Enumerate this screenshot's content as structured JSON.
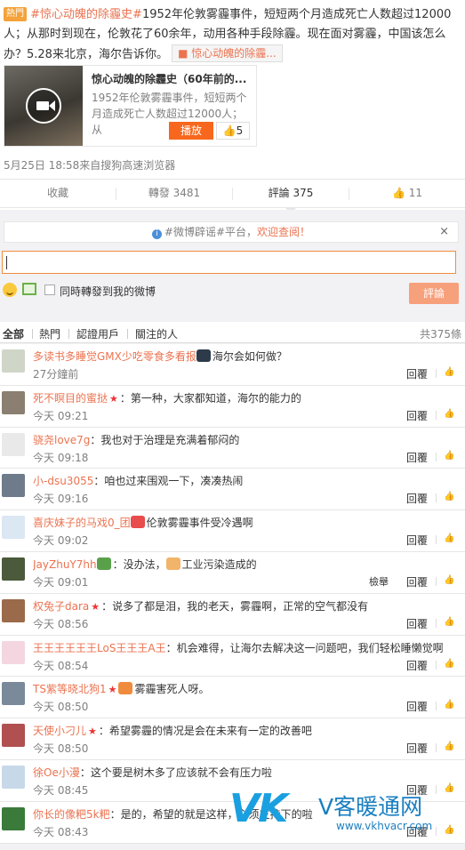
{
  "post": {
    "hot_badge": "熱門",
    "topic": "#惊心动魄的除霾史#",
    "text": "1952年伦敦雾霾事件，短短两个月造成死亡人数超过12000人；从那时到现在，伦敦花了60余年，动用各种手段除霾。现在面对雾霾，中国该怎么办？5.28来北京，海尔告诉你。",
    "inline_card": "惊心动魄的除霾...",
    "video_title": "惊心动魄的除霾史（60年前的...",
    "video_desc": "1952年伦敦雾霾事件，短短两个月造成死亡人数超过12000人；从",
    "play_label": "播放",
    "like_count": "5",
    "meta": "5月25日 18:58来自搜狗高速浏览器"
  },
  "actions": {
    "collect": "收藏",
    "repost": "轉發 3481",
    "comment": "評論 375",
    "like": "11"
  },
  "comment_box": {
    "notice_prefix": "#微博辟谣#平台，",
    "notice_link": "欢迎查阅！",
    "close": "×",
    "repost_check_label": "同時轉發到我的微博",
    "submit": "評論"
  },
  "tabs": {
    "all": "全部",
    "hot": "熱門",
    "verified": "認證用戶",
    "following": "關注的人",
    "total": "共375條"
  },
  "colors": {
    "accent": "#eb7350",
    "play": "#f7671d"
  },
  "comments": [
    {
      "user": "多读书多睡觉GMX少吃零食多看报",
      "star": false,
      "text": "海尔会如何做？",
      "sticker": "#2d3a4a",
      "time": "27分鐘前",
      "report": "",
      "reply": "回覆"
    },
    {
      "user": "死不瞑目的蜜挞",
      "star": true,
      "text": "：第一种，大家都知道，海尔的能力的",
      "sticker": "",
      "time": "今天 09:21",
      "report": "",
      "reply": "回覆"
    },
    {
      "user": "骁尧love7g",
      "star": false,
      "text": "：我也对于治理是充满着郁闷的",
      "sticker": "",
      "time": "今天 09:18",
      "report": "",
      "reply": "回覆"
    },
    {
      "user": "小-dsu3055",
      "star": false,
      "text": "：咱也过来围观一下，凑凑热闹",
      "sticker": "",
      "time": "今天 09:16",
      "report": "",
      "reply": "回覆"
    },
    {
      "user": "喜庆妹子的马戏0_团",
      "star": false,
      "text": "伦敦雾霾事件受冷遇啊",
      "sticker": "#e94c4c",
      "time": "今天 09:02",
      "report": "",
      "reply": "回覆"
    },
    {
      "user": "JayZhuY7hh",
      "star": false,
      "text": "：没办法，",
      "text2": "工业污染造成的",
      "sticker": "#5aa04a",
      "time": "今天 09:01",
      "report": "檢舉",
      "reply": "回覆"
    },
    {
      "user": "权兔子dara",
      "star": true,
      "text": "：说多了都是泪，我的老天，雾霾啊，正常的空气都没有",
      "sticker": "",
      "time": "今天 08:56",
      "report": "",
      "reply": "回覆"
    },
    {
      "user": "王王王王王王LoS王王王A王",
      "star": false,
      "text": "：机会难得，让海尔去解决这一问题吧，我们轻松睡懒觉啊",
      "sticker": "",
      "time": "今天 08:54",
      "report": "",
      "reply": "回覆"
    },
    {
      "user": "TS紫等晓北狗1",
      "star": true,
      "text": "雾霾害死人呀。",
      "sticker": "#f08b3d",
      "time": "今天 08:50",
      "report": "",
      "reply": "回覆"
    },
    {
      "user": "天使小刁儿",
      "star": true,
      "text": "：希望雾霾的情况是会在未来有一定的改善吧",
      "sticker": "",
      "time": "今天 08:50",
      "report": "",
      "reply": "回覆"
    },
    {
      "user": "徐Oe小漫",
      "star": false,
      "text": "：这个要是树木多了应该就不会有压力啦",
      "sticker": "",
      "time": "今天 08:45",
      "report": "",
      "reply": "回覆"
    },
    {
      "user": "你长的像粑5k粑",
      "star": false,
      "text": "：是的，希望的就是这样，必须支持下的啦",
      "sticker": "",
      "time": "今天 08:43",
      "report": "",
      "reply": "回覆"
    }
  ],
  "watermark": {
    "brand": "VK",
    "cn": "V客暖通网",
    "url": "www.vkhvacr.com"
  }
}
